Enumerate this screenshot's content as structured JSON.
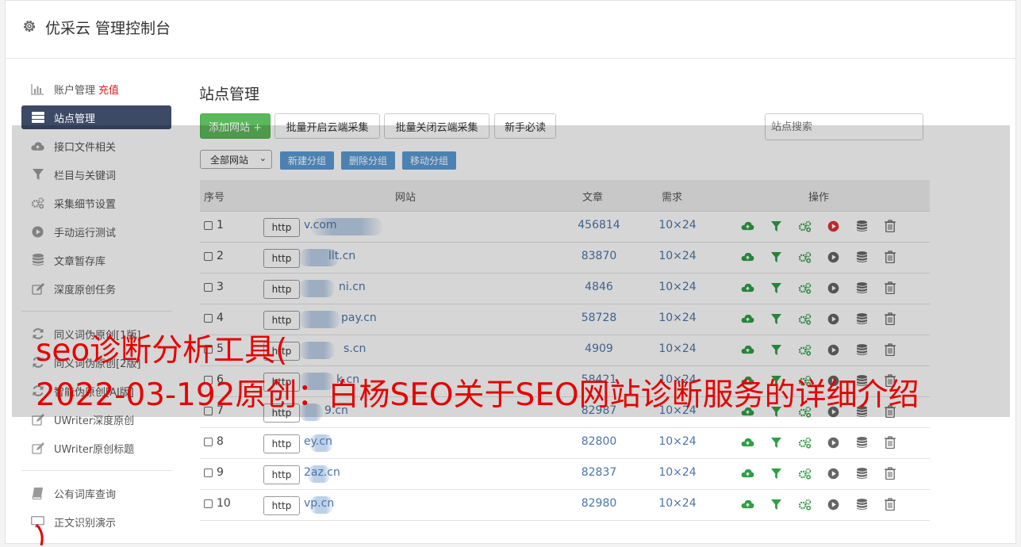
{
  "header": {
    "title": "优采云 管理控制台"
  },
  "sidebar": {
    "items": [
      {
        "label": "账户管理",
        "badge": "充值",
        "icon": "bar-chart-icon"
      },
      {
        "label": "站点管理",
        "icon": "server-icon",
        "active": true
      },
      {
        "label": "接口文件相关",
        "icon": "cloud-upload-icon"
      },
      {
        "label": "栏目与关键词",
        "icon": "filter-icon"
      },
      {
        "label": "采集细节设置",
        "icon": "gears-icon"
      },
      {
        "label": "手动运行测试",
        "icon": "play-circle-icon"
      },
      {
        "label": "文章暂存库",
        "icon": "database-icon"
      },
      {
        "label": "深度原创任务",
        "icon": "edit-icon"
      },
      {
        "label": "同义词伪原创[1版]",
        "icon": "refresh-icon"
      },
      {
        "label": "同义词伪原创[2版]",
        "icon": "refresh-icon"
      },
      {
        "label": "智能伪原创[AI版]",
        "icon": "refresh-icon"
      },
      {
        "label": "UWriter深度原创",
        "icon": "edit-icon"
      },
      {
        "label": "UWriter原创标题",
        "icon": "edit-icon"
      },
      {
        "label": "公有词库查询",
        "icon": "book-icon"
      },
      {
        "label": "正文识别演示",
        "icon": "monitor-icon"
      }
    ]
  },
  "main": {
    "title": "站点管理",
    "toolbar": {
      "add_site": "添加网站 +",
      "batch_enable": "批量开启云端采集",
      "batch_disable": "批量关闭云端采集",
      "beginner": "新手必读",
      "search_placeholder": "站点搜索"
    },
    "group_select": "全部网站",
    "group_buttons": {
      "new": "新建分组",
      "delete": "删除分组",
      "move": "移动分组"
    },
    "table": {
      "headers": {
        "no": "序号",
        "site": "网站",
        "articles": "文章",
        "demand": "需求",
        "actions": "操作"
      },
      "rows": [
        {
          "no": "1",
          "proto": "http",
          "site": "v.com",
          "articles": "456814",
          "demand": "10×24",
          "running": true
        },
        {
          "no": "2",
          "proto": "http",
          "site": "llt.cn",
          "articles": "83870",
          "demand": "10×24"
        },
        {
          "no": "3",
          "proto": "http",
          "site": "ni.cn",
          "articles": "4846",
          "demand": "10×24"
        },
        {
          "no": "4",
          "proto": "http",
          "site": "pay.cn",
          "articles": "58728",
          "demand": "10×24"
        },
        {
          "no": "5",
          "proto": "http",
          "site": "s.cn",
          "articles": "4909",
          "demand": "10×24"
        },
        {
          "no": "6",
          "proto": "http",
          "site": "k.cn",
          "articles": "58421",
          "demand": "10×24"
        },
        {
          "no": "7",
          "proto": "http",
          "site": "9.cn",
          "articles": "82987",
          "demand": "10×24"
        },
        {
          "no": "8",
          "proto": "http",
          "site": "ey.cn",
          "articles": "82800",
          "demand": "10×24"
        },
        {
          "no": "9",
          "proto": "http",
          "site": "2az.cn",
          "articles": "82837",
          "demand": "10×24"
        },
        {
          "no": "10",
          "proto": "http",
          "site": "vp.cn",
          "articles": "82980",
          "demand": "10×24"
        }
      ]
    }
  },
  "overlay": {
    "line1": "seo诊断分析工具(",
    "line2": "2022-03-192原创：白杨SEO关于SEO网站诊断服务的详细介绍"
  },
  "colors": {
    "accent_green": "#5cb85c",
    "sidebar_active": "#3c4a66",
    "link_blue": "#4a76a8",
    "overlay_red": "#e60000"
  }
}
